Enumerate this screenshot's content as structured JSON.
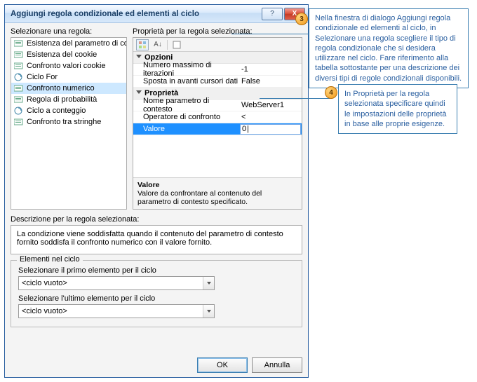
{
  "dialog": {
    "title": "Aggiungi regola condizionale ed elementi al ciclo"
  },
  "labels": {
    "select_rule": "Selezionare una regola:",
    "properties_for_rule": "Proprietà per la regola selezionata:",
    "description_for_rule": "Descrizione per la regola selezionata:",
    "loop_elements": "Elementi nel ciclo",
    "first_element": "Selezionare il primo elemento per il ciclo",
    "last_element": "Selezionare l'ultimo elemento per il ciclo"
  },
  "rules": [
    "Esistenza del parametro di contesto",
    "Esistenza del cookie",
    "Confronto valori cookie",
    "Ciclo For",
    "Confronto numerico",
    "Regola di probabilità",
    "Ciclo a conteggio",
    "Confronto tra stringhe"
  ],
  "selected_rule_index": 4,
  "properties": {
    "cat_options": "Opzioni",
    "opt_max_iter_name": "Numero massimo di iterazioni",
    "opt_max_iter_val": "-1",
    "opt_advance_name": "Sposta in avanti cursori dati",
    "opt_advance_val": "False",
    "cat_props": "Proprietà",
    "p_ctx_name": "Nome parametro di contesto",
    "p_ctx_val": "WebServer1",
    "p_op_name": "Operatore di confronto",
    "p_op_val": "<",
    "p_value_name": "Valore",
    "p_value_val": "0"
  },
  "prop_desc": {
    "title": "Valore",
    "text": "Valore da confrontare al contenuto del parametro di contesto specificato."
  },
  "description_text": "La condizione viene soddisfatta quando il contenuto del parametro di contesto fornito soddisfa il confronto numerico con il valore fornito.",
  "combo_value": "<ciclo vuoto>",
  "buttons": {
    "ok": "OK",
    "cancel": "Annulla"
  },
  "callouts": {
    "c3": "Nella finestra di dialogo Aggiungi regola condizionale ed elementi al ciclo, in Selezionare una regola scegliere il tipo di regola condizionale che si desidera utilizzare nel ciclo. Fare riferimento alla tabella sottostante per una descrizione dei diversi tipi di regole condizionali disponibili.",
    "c4": "In Proprietà per la regola selezionata specificare quindi le impostazioni delle proprietà in base alle proprie esigenze."
  },
  "badges": {
    "b3": "3",
    "b4": "4"
  }
}
